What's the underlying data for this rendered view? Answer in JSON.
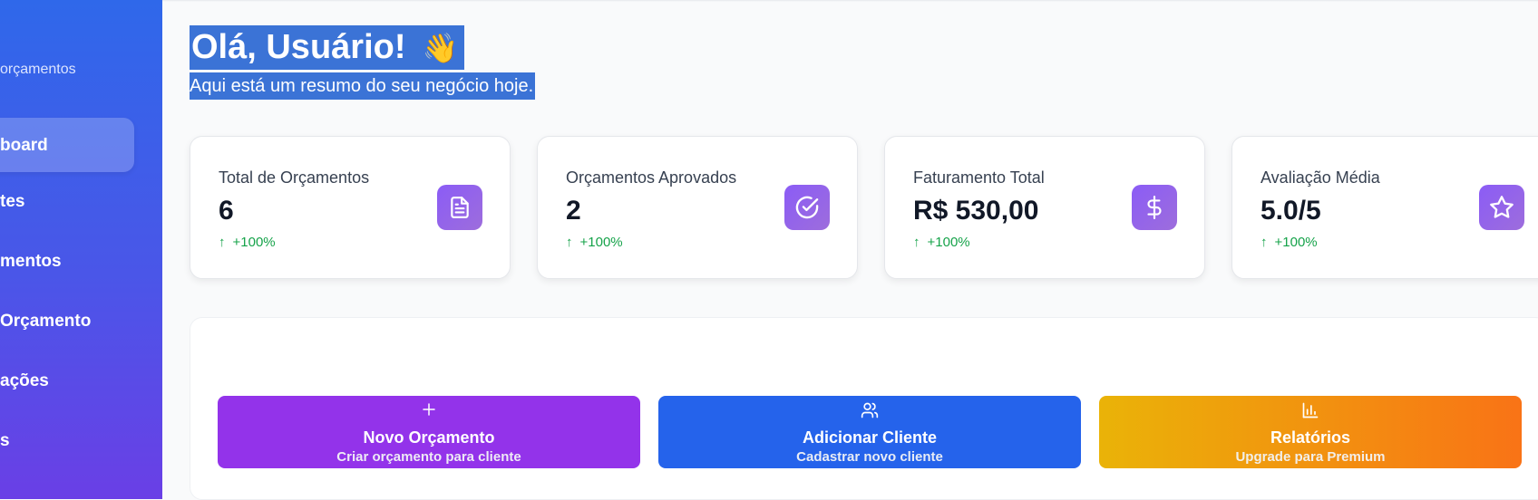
{
  "sidebar": {
    "subtitle": "orçamentos",
    "items": [
      {
        "label": "board"
      },
      {
        "label": "tes"
      },
      {
        "label": "mentos"
      },
      {
        "label": " Orçamento"
      },
      {
        "label": "ações"
      },
      {
        "label": "s"
      }
    ]
  },
  "header": {
    "greeting": "Olá, Usuário!",
    "greeting_emoji": "👋",
    "subtitle": "Aqui está um resumo do seu negócio hoje."
  },
  "stats": [
    {
      "label": "Total de Orçamentos",
      "value": "6",
      "trend": "+100%",
      "icon": "document-icon"
    },
    {
      "label": "Orçamentos Aprovados",
      "value": "2",
      "trend": "+100%",
      "icon": "check-circle-icon"
    },
    {
      "label": "Faturamento Total",
      "value": "R$ 530,00",
      "trend": "+100%",
      "icon": "dollar-icon"
    },
    {
      "label": "Avaliação Média",
      "value": "5.0/5",
      "trend": "+100%",
      "icon": "star-icon"
    }
  ],
  "actions": [
    {
      "title": "Novo Orçamento",
      "subtitle": "Criar orçamento para cliente",
      "icon": "plus-icon",
      "color": "#9333ea"
    },
    {
      "title": "Adicionar Cliente",
      "subtitle": "Cadastrar novo cliente",
      "icon": "users-icon",
      "color": "#2563eb"
    },
    {
      "title": "Relatórios",
      "subtitle": "Upgrade para Premium",
      "icon": "bar-chart-icon",
      "color": "#eab308"
    }
  ],
  "colors": {
    "trend_up": "#16a34a",
    "stat_icon_bg": "#8b5cf6",
    "highlight": "#3b73d6"
  }
}
